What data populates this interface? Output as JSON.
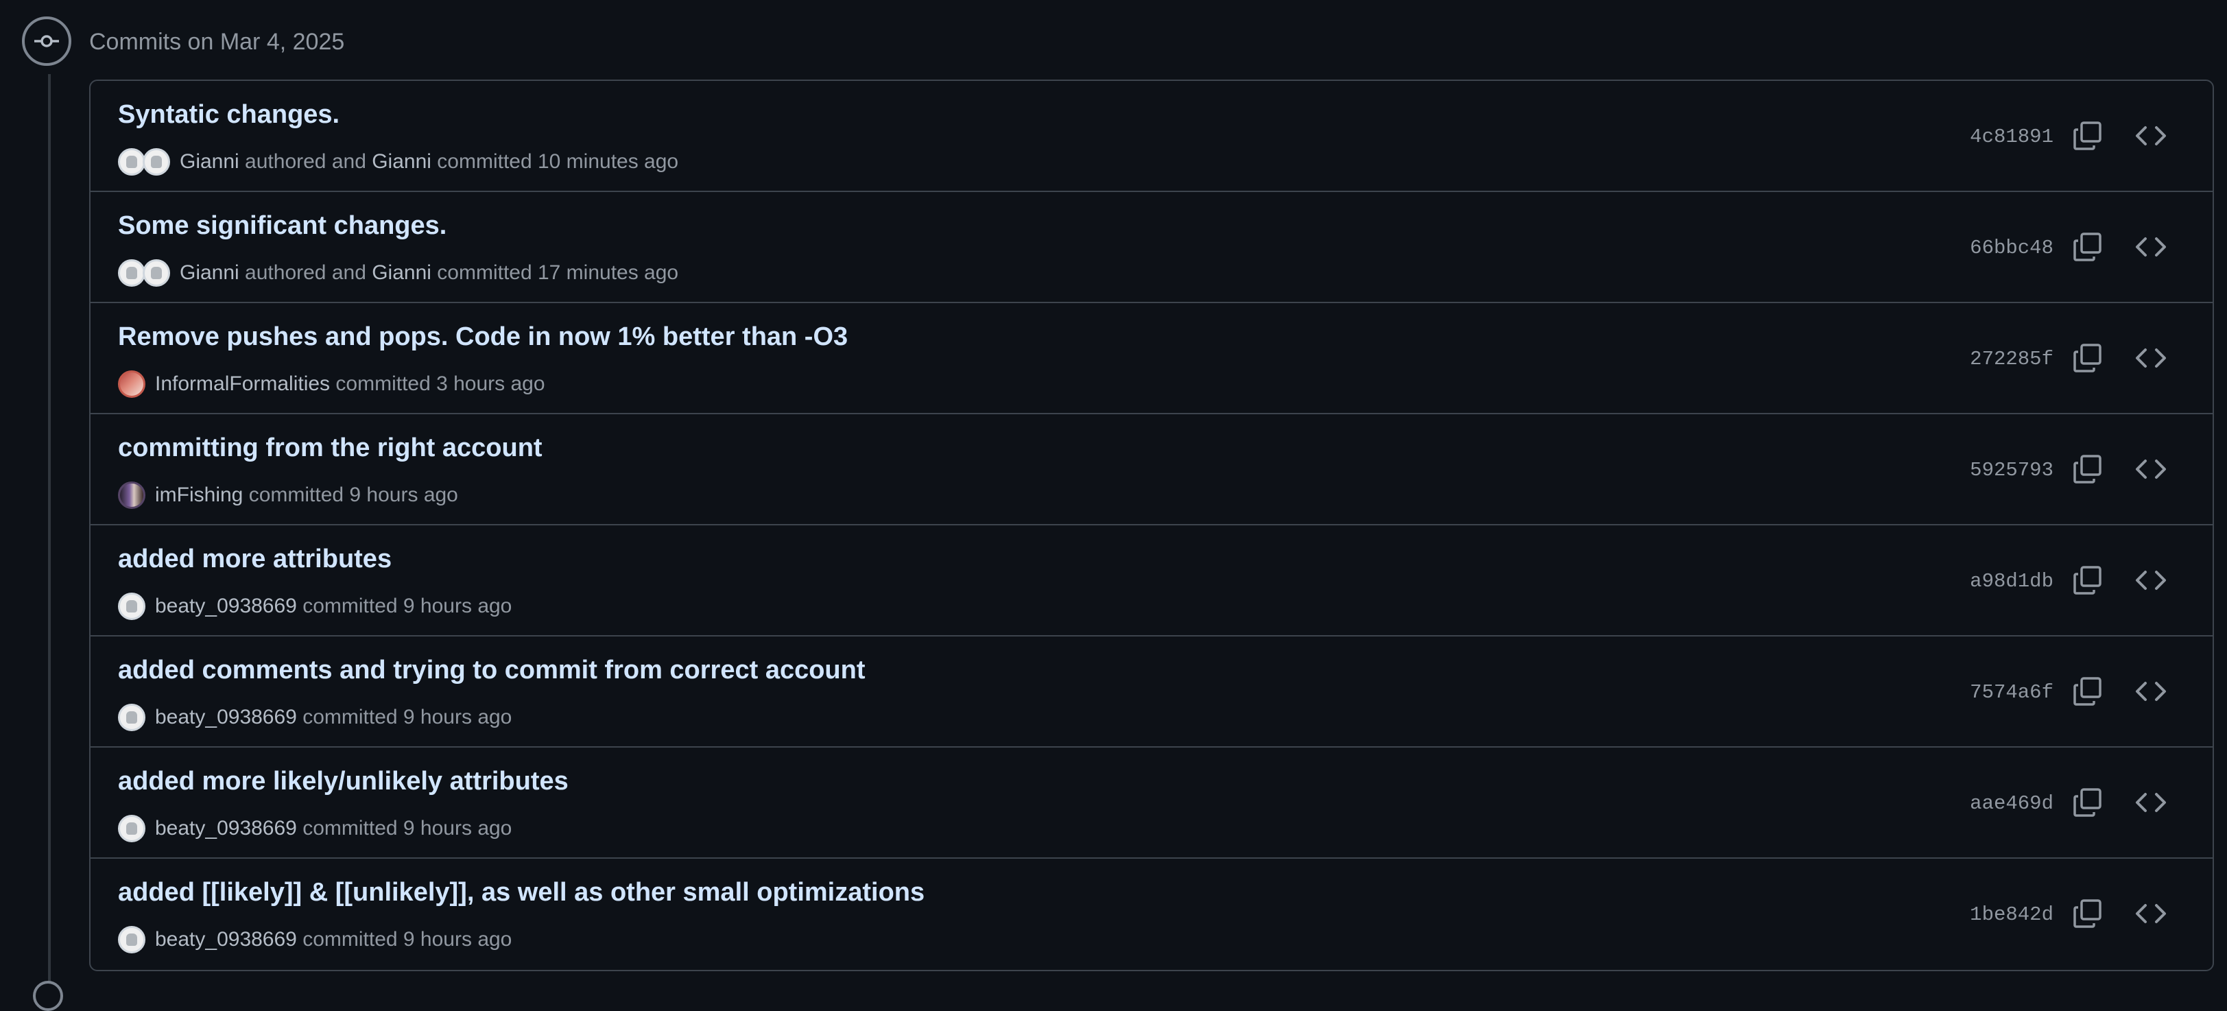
{
  "group": {
    "title": "Commits on Mar 4, 2025"
  },
  "commits": [
    {
      "title": "Syntatic changes.",
      "sha": "4c81891",
      "avatars": [
        "default",
        "default"
      ],
      "author": "Gianni",
      "mid": " authored and ",
      "committer": "Gianni",
      "time_text": " committed 10 minutes ago"
    },
    {
      "title": "Some significant changes.",
      "sha": "66bbc48",
      "avatars": [
        "default",
        "default"
      ],
      "author": "Gianni",
      "mid": " authored and ",
      "committer": "Gianni",
      "time_text": " committed 17 minutes ago"
    },
    {
      "title": "Remove pushes and pops. Code in now 1% better than -O3",
      "sha": "272285f",
      "avatars": [
        "pixel"
      ],
      "author": "InformalFormalities",
      "mid": "",
      "committer": "",
      "time_text": " committed 3 hours ago"
    },
    {
      "title": "committing from the right account",
      "sha": "5925793",
      "avatars": [
        "photo"
      ],
      "author": "imFishing",
      "mid": "",
      "committer": "",
      "time_text": " committed 9 hours ago"
    },
    {
      "title": "added more attributes",
      "sha": "a98d1db",
      "avatars": [
        "default"
      ],
      "author": "beaty_0938669",
      "mid": "",
      "committer": "",
      "time_text": " committed 9 hours ago"
    },
    {
      "title": "added comments and trying to commit from correct account",
      "sha": "7574a6f",
      "avatars": [
        "default"
      ],
      "author": "beaty_0938669",
      "mid": "",
      "committer": "",
      "time_text": " committed 9 hours ago"
    },
    {
      "title": "added more likely/unlikely attributes",
      "sha": "aae469d",
      "avatars": [
        "default"
      ],
      "author": "beaty_0938669",
      "mid": "",
      "committer": "",
      "time_text": " committed 9 hours ago"
    },
    {
      "title": "added [[likely]] & [[unlikely]], as well as other small optimizations",
      "sha": "1be842d",
      "avatars": [
        "default"
      ],
      "author": "beaty_0938669",
      "mid": "",
      "committer": "",
      "time_text": " committed 9 hours ago"
    }
  ],
  "icons": {
    "node": "git-commit-icon",
    "copy": "copy-icon",
    "browse": "code-icon"
  }
}
